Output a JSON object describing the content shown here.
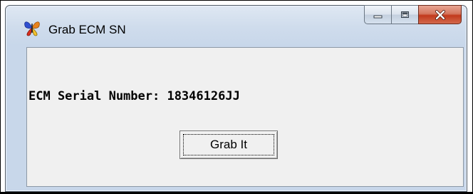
{
  "window": {
    "title": "Grab ECM SN",
    "caption_buttons": [
      "minimize",
      "maximize",
      "close"
    ]
  },
  "content": {
    "serial_label": "ECM Serial Number: 18346126JJ",
    "grab_button_label": "Grab It"
  },
  "colors": {
    "client_background": "#f0f0f0",
    "close_button": "#c2391c",
    "frame": "#c8d7ea"
  },
  "icons": {
    "app": "butterfly-app-icon",
    "minimize": "minimize-icon",
    "maximize": "maximize-icon",
    "close": "close-icon"
  }
}
